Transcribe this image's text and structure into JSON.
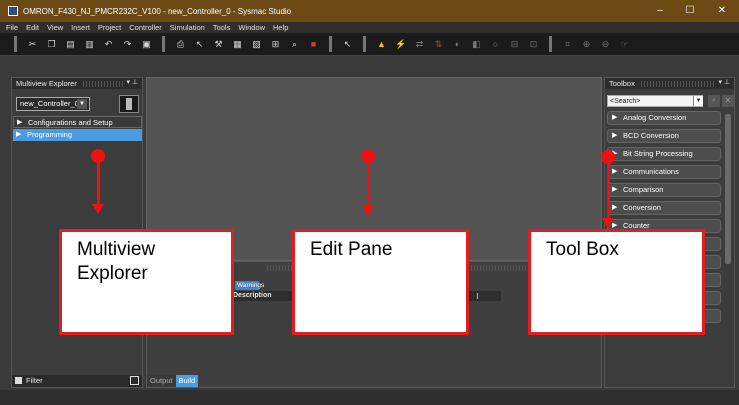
{
  "window": {
    "title": "OMRON_F430_NJ_PMCR232C_V100 - new_Controller_0 - Sysmac Studio",
    "minimize": "–",
    "maximize": "☐",
    "close": "✕"
  },
  "menu": [
    "File",
    "Edit",
    "View",
    "Insert",
    "Project",
    "Controller",
    "Simulation",
    "Tools",
    "Window",
    "Help"
  ],
  "explorer": {
    "title": "Multiview Explorer",
    "pin_controls": "▾ ⊥",
    "controller": "new_Controller_0",
    "tree": [
      {
        "label": "Configurations and Setup",
        "arrow": "▶"
      },
      {
        "label": "Programming",
        "arrow": "▶"
      }
    ],
    "filter_label": "Filter"
  },
  "output": {
    "warnings_tab": "Warnings",
    "description_header": "Description",
    "tabs": [
      "Output",
      "Build"
    ]
  },
  "toolbox": {
    "title": "Toolbox",
    "pin_controls": "▾ ⊥",
    "search_placeholder": "<Search>",
    "categories": [
      "Analog Conversion",
      "BCD Conversion",
      "Bit String Processing",
      "Communications",
      "Comparison",
      "Conversion",
      "Counter"
    ]
  },
  "callouts": {
    "explorer": "Multiview Explorer",
    "edit_pane": "Edit Pane",
    "tool_box": "Tool Box"
  },
  "colors": {
    "title_bar": "#6b4a16",
    "selection": "#4a9be0",
    "callout_border": "#e31e1e"
  }
}
